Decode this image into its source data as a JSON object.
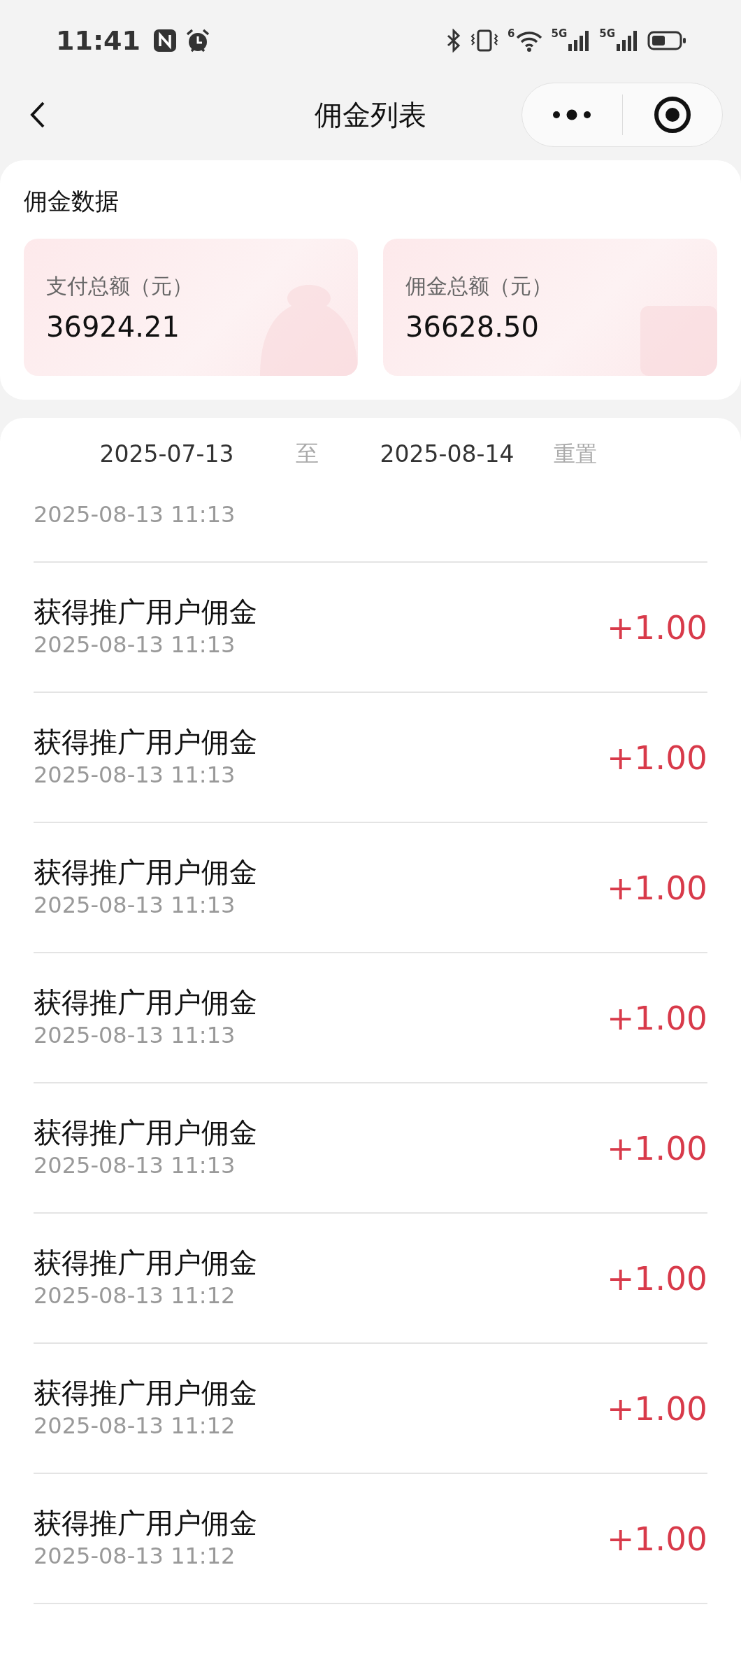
{
  "status_bar": {
    "time": "11:41",
    "wifi_badge": "6",
    "signal_1": "5G",
    "signal_2": "5G"
  },
  "nav": {
    "title": "佣金列表"
  },
  "summary": {
    "title": "佣金数据",
    "stats": [
      {
        "label": "支付总额（元）",
        "value": "36924.21"
      },
      {
        "label": "佣金总额（元）",
        "value": "36628.50"
      }
    ]
  },
  "filter": {
    "start_date": "2025-07-13",
    "separator": "至",
    "end_date": "2025-08-14",
    "reset": "重置"
  },
  "records": [
    {
      "time": "2025-08-13 11:13"
    },
    {
      "title": "获得推广用户佣金",
      "time": "2025-08-13 11:13",
      "amount": "+1.00"
    },
    {
      "title": "获得推广用户佣金",
      "time": "2025-08-13 11:13",
      "amount": "+1.00"
    },
    {
      "title": "获得推广用户佣金",
      "time": "2025-08-13 11:13",
      "amount": "+1.00"
    },
    {
      "title": "获得推广用户佣金",
      "time": "2025-08-13 11:13",
      "amount": "+1.00"
    },
    {
      "title": "获得推广用户佣金",
      "time": "2025-08-13 11:13",
      "amount": "+1.00"
    },
    {
      "title": "获得推广用户佣金",
      "time": "2025-08-13 11:12",
      "amount": "+1.00"
    },
    {
      "title": "获得推广用户佣金",
      "time": "2025-08-13 11:12",
      "amount": "+1.00"
    },
    {
      "title": "获得推广用户佣金",
      "time": "2025-08-13 11:12",
      "amount": "+1.00"
    }
  ]
}
